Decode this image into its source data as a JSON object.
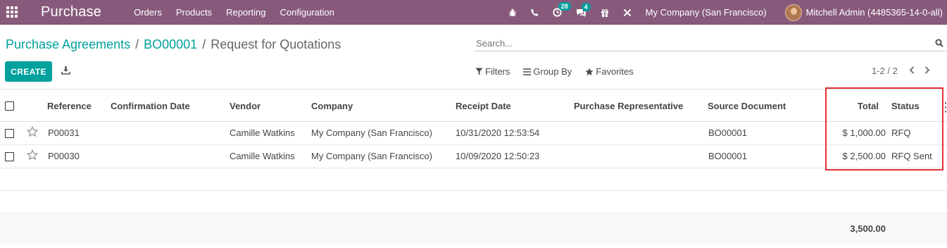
{
  "navbar": {
    "app_title": "Purchase",
    "menu": [
      "Orders",
      "Products",
      "Reporting",
      "Configuration"
    ],
    "activity_count": "28",
    "messages_count": "4",
    "company": "My Company (San Francisco)",
    "user": "Mitchell Admin (4485365-14-0-all)"
  },
  "breadcrumb": {
    "items": [
      "Purchase Agreements",
      "BO00001"
    ],
    "current": "Request for Quotations",
    "separator": "/"
  },
  "search": {
    "placeholder": "Search..."
  },
  "toolbar": {
    "create_label": "CREATE",
    "filters_label": "Filters",
    "groupby_label": "Group By",
    "favorites_label": "Favorites"
  },
  "pager": {
    "range": "1-2 / 2"
  },
  "table": {
    "columns": {
      "reference": "Reference",
      "confirmation_date": "Confirmation Date",
      "vendor": "Vendor",
      "company": "Company",
      "receipt_date": "Receipt Date",
      "purchase_rep": "Purchase Representative",
      "source_document": "Source Document",
      "total": "Total",
      "status": "Status"
    },
    "rows": [
      {
        "reference": "P00031",
        "confirmation_date": "",
        "vendor": "Camille Watkins",
        "company": "My Company (San Francisco)",
        "receipt_date": "10/31/2020 12:53:54",
        "purchase_rep": "",
        "source_document": "BO00001",
        "total": "$ 1,000.00",
        "status": "RFQ"
      },
      {
        "reference": "P00030",
        "confirmation_date": "",
        "vendor": "Camille Watkins",
        "company": "My Company (San Francisco)",
        "receipt_date": "10/09/2020 12:50:23",
        "purchase_rep": "",
        "source_document": "BO00001",
        "total": "$ 2,500.00",
        "status": "RFQ Sent"
      }
    ],
    "grand_total": "3,500.00"
  },
  "colors": {
    "navbar": "#875a7b",
    "accent": "#00a09d",
    "highlight": "#e53030"
  }
}
